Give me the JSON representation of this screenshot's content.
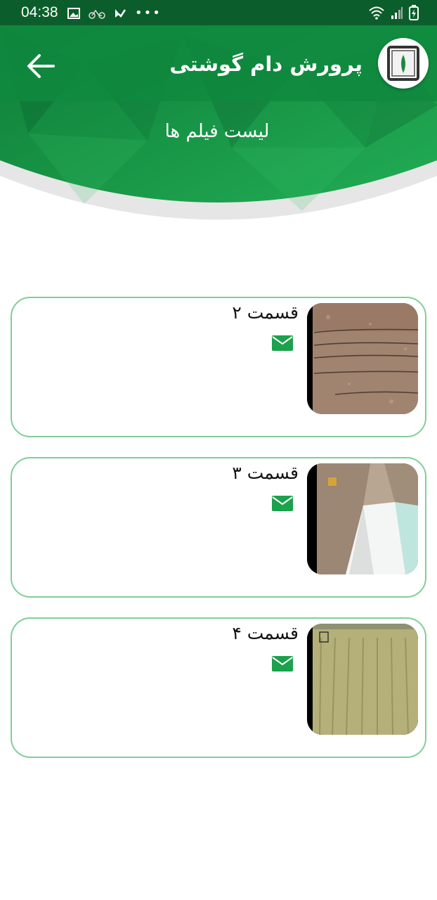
{
  "status_bar": {
    "time": "04:38"
  },
  "header": {
    "title": "پرورش دام گوشتی",
    "section_title": "لیست فیلم ها",
    "colors": {
      "dark_green": "#0e7a38",
      "green": "#1aa24c",
      "light_green": "#2cb85c"
    }
  },
  "videos": [
    {
      "title": "قسمت ۲",
      "thumbnail": "dry-soil-photo",
      "action_icon": "mail-icon"
    },
    {
      "title": "قسمت ۳",
      "thumbnail": "canal-rocks-photo",
      "action_icon": "mail-icon"
    },
    {
      "title": "قسمت ۴",
      "thumbnail": "rice-field-photo",
      "action_icon": "mail-icon"
    }
  ]
}
